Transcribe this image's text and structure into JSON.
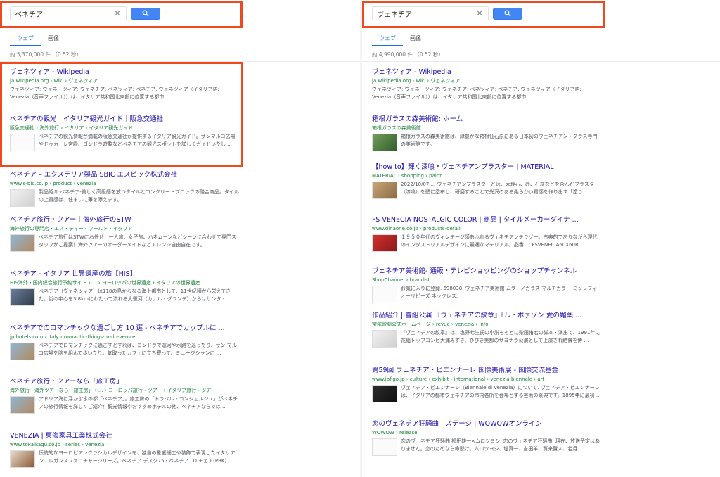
{
  "left": {
    "search": {
      "query": "ベネチア"
    },
    "tabs": [
      "ウェブ",
      "画像"
    ],
    "result_count": "約 5,370,000 件 （0.52 秒）",
    "results": [
      {
        "title": "ヴェネツィア - Wikipedia",
        "url": "ja.wikipedia.org › wiki › ヴェネツィア",
        "snippet": "ヴェネツィア; ヴェネーツィア; ヴェネチア; ベネツィア; ベネチア. ヴェネツィア（イタリア語: Venezia（音声ファイル））は、イタリア共和国北東部に位置する都市 ..."
      },
      {
        "title": "ベネチアの観光｜イタリア観光ガイド｜阪急交通社",
        "url": "阪急交通社 › 海外旅行 › イタリア › イタリア観光ガイド",
        "snippet": "ベネチアの観光情報が満載の阪急交通社が提供するイタリア観光ガイド。サンマルコ広場やドゥカーレ宮殿、ゴンドラ遊覧などベネチアの観光スポットを詳しくガイドいたし ..."
      },
      {
        "title": "ベネチア – エクステリア製品 SBIC エスビック株式会社",
        "url": "www.s-bic.co.jp › product › venezia",
        "snippet": "製品紹介:ベネチア-美しく高級感を放つタイルとコンクリートブロックの融合商品。タイルの上質感は、住まいに華を添えます。"
      },
      {
        "title": "ベネチア旅行・ツアー｜海外旅行のSTW",
        "url": "海外旅行の専門店・エス・ティー・ワールド › イタリア",
        "snippet": "ベネチア旅行はSTWにお任せ！一人旅、女子旅、ハネムーンなどシーンに合わせて専門スタッフがご提案！海外ツアーのオーダーメイドなどアレンジ自由自在です。"
      },
      {
        "title": "ベネチア - イタリア 世界遺産の旅【HIS】",
        "url": "HIS海外・国内総合旅行予約サイト › ... › ヨーロッパの世界遺産 › イタリアの世界遺産",
        "snippet": "ベネチア（ヴェネツィア）は118の島からなる海上都市として、11世紀頃から栄えてきた。街の中心を3.8kmにわたって流れる大運河（カナル・グランデ）からはサンタ・..."
      },
      {
        "title": "ベネチアでのロマンチックな過ごし方 10 選 - ベネチアでカップルに ...",
        "url": "jp.hotels.com › italy › romantic-things-to-do-venice",
        "snippet": "ベネチアでロマンチックに過ごすとすれば、ゴンドラで運河や水路を巡ったり、サン マルコ広場を腕を組んで歩いたり。気取ったカフェに立ち寄って、ミュージシャンに ..."
      },
      {
        "title": "ベネチア旅行・ツアーなら「旅工房」",
        "url": "海外旅行・海外ツアーなら「旅工房」 › ... › ヨーロッパ旅行・ツアー › イタリア旅行・ツアー",
        "snippet": "アドリア海に浮かぶ水の都「ベネチア」。旅工房の「トラベル・コンシェルジュ」がベネチアの旅行情報を詳しくご紹介！観光情報やおすすめホテルの他、ベネチアならでは ..."
      },
      {
        "title": "VENEZIA | 東海家具工業株式会社",
        "url": "www.tokaikagu.co.jp › series › venezia",
        "snippet": "伝統的なヨーロピアンクラシカルデザインを、独自の象嵌細工や装飾で表現したイタリアンエレガンスファニチャーシリーズ。ベネチア デスク75・ベネチア LD チェア(PBK)."
      }
    ]
  },
  "right": {
    "search": {
      "query": "ヴェネチア"
    },
    "tabs": [
      "ウェブ",
      "画像"
    ],
    "result_count": "約 4,990,000 件 （0.52 秒）",
    "results": [
      {
        "title": "ヴェネツィア - Wikipedia",
        "url": "ja.wikipedia.org › wiki › ヴェネツィア",
        "snippet": "ヴェネツィア; ヴェネーツィア; ヴェネチア; ベネツィア; ベネチア. ヴェネツィア（イタリア語: Venezia（音声ファイル））は、イタリア共和国北東部に位置する都市 ..."
      },
      {
        "title": "箱根ガラスの森美術館: ホーム",
        "url": "箱根ガラスの森美術館",
        "snippet": "箱根ガラスの森美術館は、緑豊かな箱根仙石原にある日本初のヴェネチアン・グラス専門の美術館です。"
      },
      {
        "title": "【how to】輝く漆喰・ヴェネチアンプラスター | MATERIAL",
        "url": "MATERIAL › shopping › paint",
        "snippet": "2022/10/07 ... ヴェネチアンプラスターとは、大理石、砂、石灰などを含んだプラスター（漆喰）を壁に塗布し、研磨することで光沢のある柔らかい質感を作り出す「塗り ..."
      },
      {
        "title": "FS VENECIA NOSTALGIC COLOR | 商品 | タイルメーカーダイナ ...",
        "url": "www.dinaone.co.jp › products-detail",
        "snippet": "１９５０年代のヴィンテージ感あふれるヴェネチアンテラゾー。古典的でありながら現代のインダストリアルデザインに最適なマテリアル。品番：: FSVENECIA60X60R."
      },
      {
        "title": "ヴェネチア美術館- 通販・テレビショッピングのショップチャンネル",
        "url": "ShopChannel › brandlst",
        "snippet": "お気に入りに登録. 698038. ヴェネチア美術館 ムラーノガラス マルチカラー ミッレフィオーリピーズ ネックレス."
      },
      {
        "title": "作品紹介 | 雪組公演 『ヴェネチアの紋章』『ル・ポァゾン 愛の媚薬 ...",
        "url": "宝塚歌劇公式ホームページ › revue › venezia › info",
        "snippet": "『ヴェネチアの紋章』は、塩野七生氏の小説をもとに柴田侑宏の脚本・演出で、1991年に花組トップコンビ大浦みずき、ひびき美都のサヨナラ公演として上演され絶賛を博 ..."
      },
      {
        "title": "第59回 ヴェネチア・ビエンナーレ 国際美術展 - 国際交流基金",
        "url": "www.jpf.go.jp › culture › exhibit › international › venezia-biennale › art",
        "snippet": "ヴェネチア・ビエンナーレ（Biennale di Venezia）について. ヴェネチア・ビエンナーレは、イタリアの都市ヴェネチアの市内各所を会場とする芸術の祭典です。1895年に最初 ..."
      },
      {
        "title": "恋のヴェネチア狂騒曲 | ステージ | WOWOWオンライン",
        "url": "WOWOW › release",
        "snippet": "恋のヴェネチア狂騒曲 福田雄一×ムロツヨシ. 恋のヴェネチア狂騒曲. 現在、放送予定はありません。恋のためなら命懸け。ムロツヨシ、堤真一、吉田羊、賀来賢人、若月 ..."
      }
    ]
  }
}
